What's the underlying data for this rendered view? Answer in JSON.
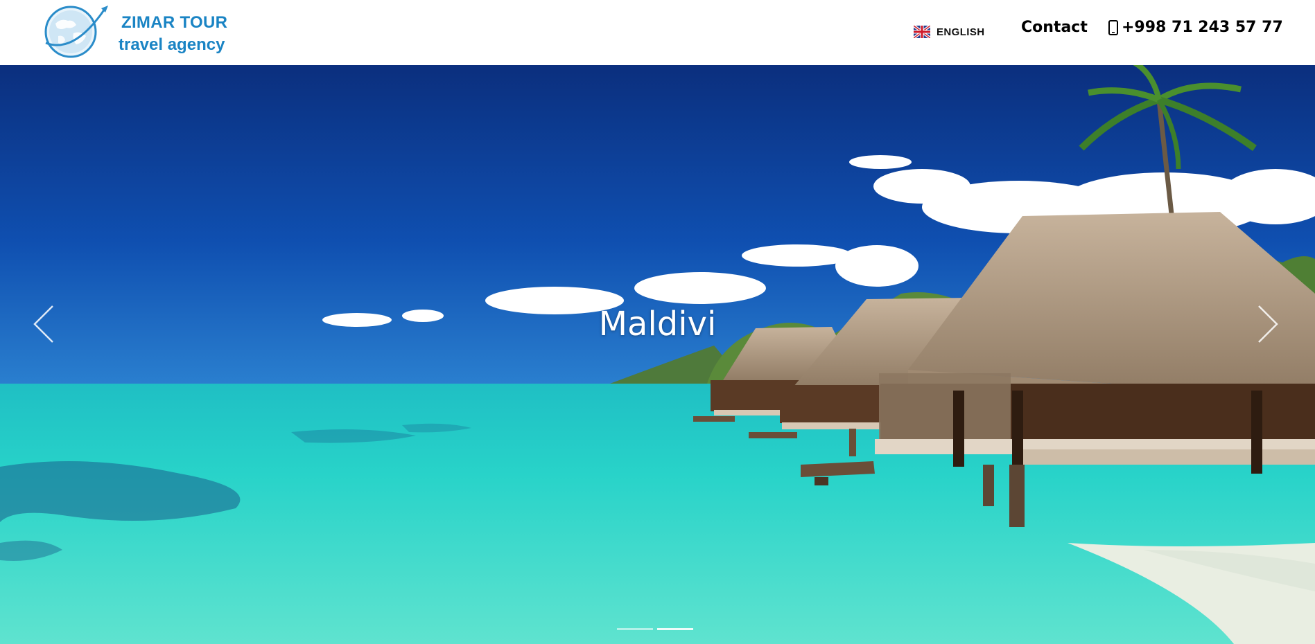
{
  "header": {
    "logo": {
      "line1": "ZIMAR TOUR",
      "line2": "travel agency",
      "icon": "globe-airplane-icon"
    },
    "language": {
      "label": "ENGLISH",
      "flag": "uk-flag-icon"
    },
    "contact_label": "Contact",
    "phone": {
      "number": "+998 71 243 57 77",
      "icon": "mobile-phone-icon"
    }
  },
  "slider": {
    "caption": "Maldivi",
    "prev_icon": "chevron-left-icon",
    "next_icon": "chevron-right-icon",
    "dots": 2,
    "active_dot": 1
  },
  "colors": {
    "brand": "#1a84c4",
    "text": "#000000",
    "sky": "#0d4aa6",
    "sea": "#2fd3c8"
  }
}
